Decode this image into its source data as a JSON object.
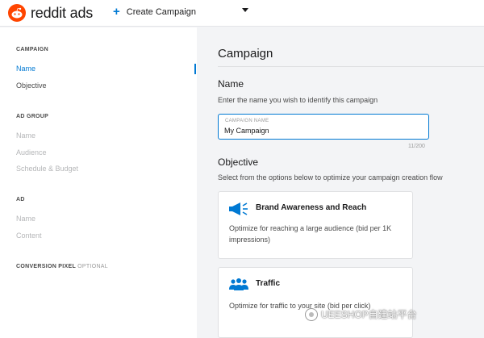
{
  "header": {
    "brand": "reddit ads",
    "create_label": "Create Campaign"
  },
  "sidebar": {
    "campaign": {
      "heading": "CAMPAIGN",
      "items": [
        {
          "label": "Name",
          "state": "active"
        },
        {
          "label": "Objective",
          "state": "enabled"
        }
      ]
    },
    "ad_group": {
      "heading": "AD GROUP",
      "items": [
        {
          "label": "Name",
          "state": "disabled"
        },
        {
          "label": "Audience",
          "state": "disabled"
        },
        {
          "label": "Schedule & Budget",
          "state": "disabled"
        }
      ]
    },
    "ad": {
      "heading": "AD",
      "items": [
        {
          "label": "Name",
          "state": "disabled"
        },
        {
          "label": "Content",
          "state": "disabled"
        }
      ]
    },
    "conversion": {
      "heading": "CONVERSION PIXEL",
      "optional": "OPTIONAL"
    }
  },
  "main": {
    "title": "Campaign",
    "name_section": {
      "heading": "Name",
      "description": "Enter the name you wish to identify this campaign",
      "field_label": "CAMPAIGN NAME",
      "field_value": "My Campaign",
      "counter": "11/200"
    },
    "objective_section": {
      "heading": "Objective",
      "description": "Select from the options below to optimize your campaign creation flow",
      "options": [
        {
          "title": "Brand Awareness and Reach",
          "description": "Optimize for reaching a large audience (bid per 1K impressions)",
          "icon": "megaphone-icon"
        },
        {
          "title": "Traffic",
          "description": "Optimize for traffic to your site (bid per click)",
          "icon": "people-icon"
        }
      ]
    }
  },
  "watermark": {
    "text": "UEESHOP自建站平台"
  },
  "colors": {
    "accent": "#0079d3",
    "brand": "#ff4500",
    "icon": "#0079d3"
  }
}
